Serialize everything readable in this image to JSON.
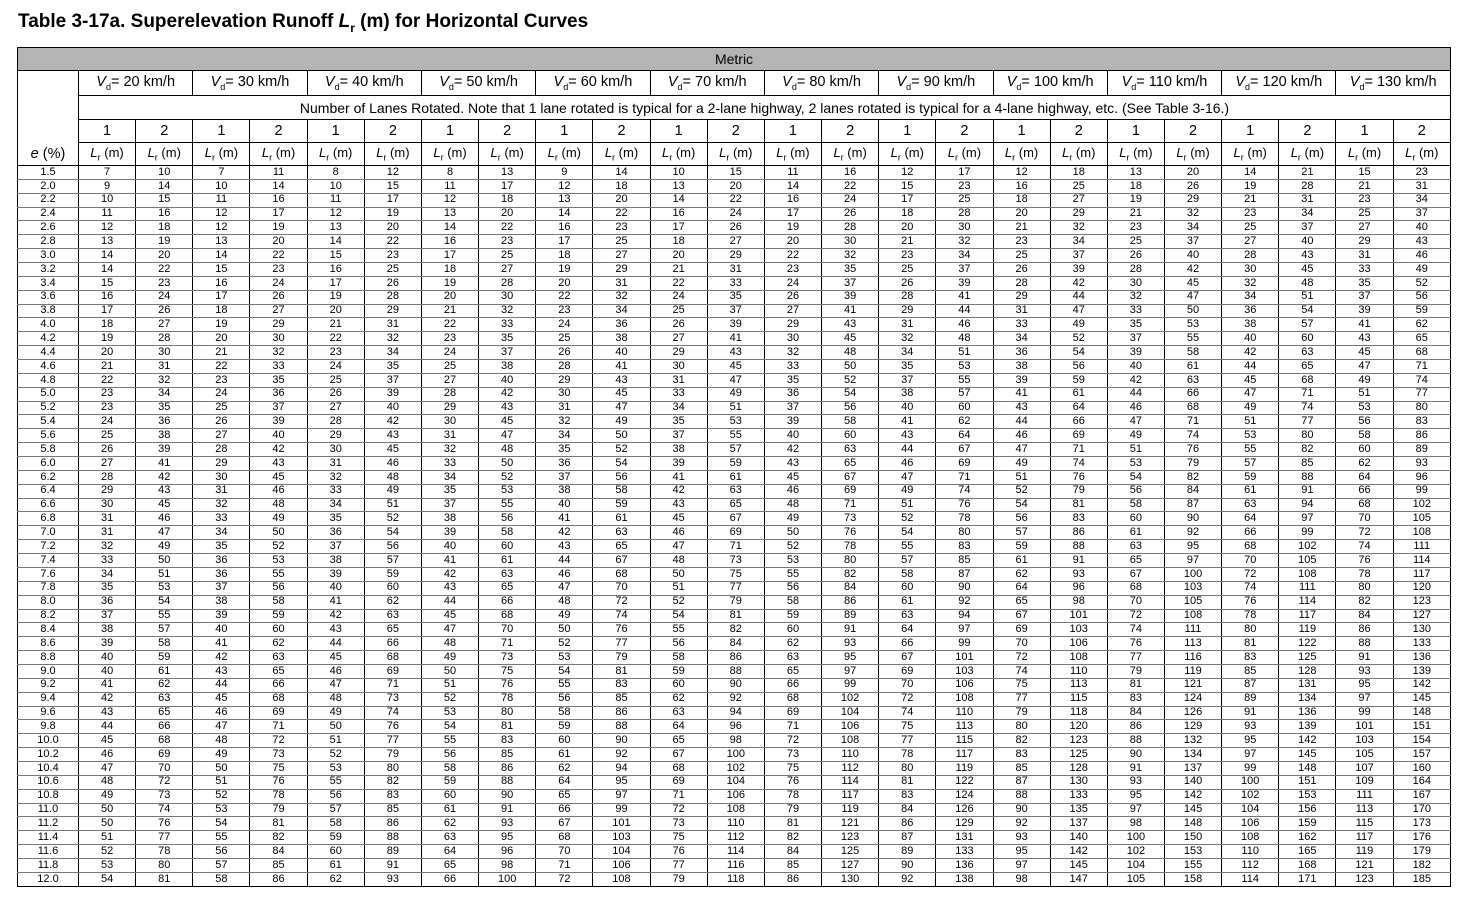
{
  "title": {
    "prefix": "Table 3-17a. Superelevation Runoff ",
    "var": "L",
    "sub": "r",
    "suffix": " (m) for Horizontal Curves"
  },
  "header": {
    "metric": "Metric",
    "e_label": "e (%)",
    "speeds": [
      "20 km/h",
      "30 km/h",
      "40 km/h",
      "50 km/h",
      "60 km/h",
      "70 km/h",
      "80 km/h",
      "90 km/h",
      "100 km/h",
      "110 km/h",
      "120 km/h",
      "130 km/h"
    ],
    "speed_var": "V",
    "speed_sub": "d",
    "note": "Number of Lanes Rotated. Note that 1 lane rotated is typical for a 2-lane highway, 2 lanes rotated is typical for a 4-lane highway, etc. (See Table 3-16.)",
    "lanes": [
      "1",
      "2"
    ],
    "unit_var": "L",
    "unit_sub": "r",
    "unit_suffix": " (m)"
  },
  "rows": [
    [
      "1.5",
      "7",
      "10",
      "7",
      "11",
      "8",
      "12",
      "8",
      "13",
      "9",
      "14",
      "10",
      "15",
      "11",
      "16",
      "12",
      "17",
      "12",
      "18",
      "13",
      "20",
      "14",
      "21",
      "15",
      "23"
    ],
    [
      "2.0",
      "9",
      "14",
      "10",
      "14",
      "10",
      "15",
      "11",
      "17",
      "12",
      "18",
      "13",
      "20",
      "14",
      "22",
      "15",
      "23",
      "16",
      "25",
      "18",
      "26",
      "19",
      "28",
      "21",
      "31"
    ],
    [
      "2.2",
      "10",
      "15",
      "11",
      "16",
      "11",
      "17",
      "12",
      "18",
      "13",
      "20",
      "14",
      "22",
      "16",
      "24",
      "17",
      "25",
      "18",
      "27",
      "19",
      "29",
      "21",
      "31",
      "23",
      "34"
    ],
    [
      "2.4",
      "11",
      "16",
      "12",
      "17",
      "12",
      "19",
      "13",
      "20",
      "14",
      "22",
      "16",
      "24",
      "17",
      "26",
      "18",
      "28",
      "20",
      "29",
      "21",
      "32",
      "23",
      "34",
      "25",
      "37"
    ],
    [
      "2.6",
      "12",
      "18",
      "12",
      "19",
      "13",
      "20",
      "14",
      "22",
      "16",
      "23",
      "17",
      "26",
      "19",
      "28",
      "20",
      "30",
      "21",
      "32",
      "23",
      "34",
      "25",
      "37",
      "27",
      "40"
    ],
    [
      "2.8",
      "13",
      "19",
      "13",
      "20",
      "14",
      "22",
      "16",
      "23",
      "17",
      "25",
      "18",
      "27",
      "20",
      "30",
      "21",
      "32",
      "23",
      "34",
      "25",
      "37",
      "27",
      "40",
      "29",
      "43"
    ],
    [
      "3.0",
      "14",
      "20",
      "14",
      "22",
      "15",
      "23",
      "17",
      "25",
      "18",
      "27",
      "20",
      "29",
      "22",
      "32",
      "23",
      "34",
      "25",
      "37",
      "26",
      "40",
      "28",
      "43",
      "31",
      "46"
    ],
    [
      "3.2",
      "14",
      "22",
      "15",
      "23",
      "16",
      "25",
      "18",
      "27",
      "19",
      "29",
      "21",
      "31",
      "23",
      "35",
      "25",
      "37",
      "26",
      "39",
      "28",
      "42",
      "30",
      "45",
      "33",
      "49"
    ],
    [
      "3.4",
      "15",
      "23",
      "16",
      "24",
      "17",
      "26",
      "19",
      "28",
      "20",
      "31",
      "22",
      "33",
      "24",
      "37",
      "26",
      "39",
      "28",
      "42",
      "30",
      "45",
      "32",
      "48",
      "35",
      "52"
    ],
    [
      "3.6",
      "16",
      "24",
      "17",
      "26",
      "19",
      "28",
      "20",
      "30",
      "22",
      "32",
      "24",
      "35",
      "26",
      "39",
      "28",
      "41",
      "29",
      "44",
      "32",
      "47",
      "34",
      "51",
      "37",
      "56"
    ],
    [
      "3.8",
      "17",
      "26",
      "18",
      "27",
      "20",
      "29",
      "21",
      "32",
      "23",
      "34",
      "25",
      "37",
      "27",
      "41",
      "29",
      "44",
      "31",
      "47",
      "33",
      "50",
      "36",
      "54",
      "39",
      "59"
    ],
    [
      "4.0",
      "18",
      "27",
      "19",
      "29",
      "21",
      "31",
      "22",
      "33",
      "24",
      "36",
      "26",
      "39",
      "29",
      "43",
      "31",
      "46",
      "33",
      "49",
      "35",
      "53",
      "38",
      "57",
      "41",
      "62"
    ],
    [
      "4.2",
      "19",
      "28",
      "20",
      "30",
      "22",
      "32",
      "23",
      "35",
      "25",
      "38",
      "27",
      "41",
      "30",
      "45",
      "32",
      "48",
      "34",
      "52",
      "37",
      "55",
      "40",
      "60",
      "43",
      "65"
    ],
    [
      "4.4",
      "20",
      "30",
      "21",
      "32",
      "23",
      "34",
      "24",
      "37",
      "26",
      "40",
      "29",
      "43",
      "32",
      "48",
      "34",
      "51",
      "36",
      "54",
      "39",
      "58",
      "42",
      "63",
      "45",
      "68"
    ],
    [
      "4.6",
      "21",
      "31",
      "22",
      "33",
      "24",
      "35",
      "25",
      "38",
      "28",
      "41",
      "30",
      "45",
      "33",
      "50",
      "35",
      "53",
      "38",
      "56",
      "40",
      "61",
      "44",
      "65",
      "47",
      "71"
    ],
    [
      "4.8",
      "22",
      "32",
      "23",
      "35",
      "25",
      "37",
      "27",
      "40",
      "29",
      "43",
      "31",
      "47",
      "35",
      "52",
      "37",
      "55",
      "39",
      "59",
      "42",
      "63",
      "45",
      "68",
      "49",
      "74"
    ],
    [
      "5.0",
      "23",
      "34",
      "24",
      "36",
      "26",
      "39",
      "28",
      "42",
      "30",
      "45",
      "33",
      "49",
      "36",
      "54",
      "38",
      "57",
      "41",
      "61",
      "44",
      "66",
      "47",
      "71",
      "51",
      "77"
    ],
    [
      "5.2",
      "23",
      "35",
      "25",
      "37",
      "27",
      "40",
      "29",
      "43",
      "31",
      "47",
      "34",
      "51",
      "37",
      "56",
      "40",
      "60",
      "43",
      "64",
      "46",
      "68",
      "49",
      "74",
      "53",
      "80"
    ],
    [
      "5.4",
      "24",
      "36",
      "26",
      "39",
      "28",
      "42",
      "30",
      "45",
      "32",
      "49",
      "35",
      "53",
      "39",
      "58",
      "41",
      "62",
      "44",
      "66",
      "47",
      "71",
      "51",
      "77",
      "56",
      "83"
    ],
    [
      "5.6",
      "25",
      "38",
      "27",
      "40",
      "29",
      "43",
      "31",
      "47",
      "34",
      "50",
      "37",
      "55",
      "40",
      "60",
      "43",
      "64",
      "46",
      "69",
      "49",
      "74",
      "53",
      "80",
      "58",
      "86"
    ],
    [
      "5.8",
      "26",
      "39",
      "28",
      "42",
      "30",
      "45",
      "32",
      "48",
      "35",
      "52",
      "38",
      "57",
      "42",
      "63",
      "44",
      "67",
      "47",
      "71",
      "51",
      "76",
      "55",
      "82",
      "60",
      "89"
    ],
    [
      "6.0",
      "27",
      "41",
      "29",
      "43",
      "31",
      "46",
      "33",
      "50",
      "36",
      "54",
      "39",
      "59",
      "43",
      "65",
      "46",
      "69",
      "49",
      "74",
      "53",
      "79",
      "57",
      "85",
      "62",
      "93"
    ],
    [
      "6.2",
      "28",
      "42",
      "30",
      "45",
      "32",
      "48",
      "34",
      "52",
      "37",
      "56",
      "41",
      "61",
      "45",
      "67",
      "47",
      "71",
      "51",
      "76",
      "54",
      "82",
      "59",
      "88",
      "64",
      "96"
    ],
    [
      "6.4",
      "29",
      "43",
      "31",
      "46",
      "33",
      "49",
      "35",
      "53",
      "38",
      "58",
      "42",
      "63",
      "46",
      "69",
      "49",
      "74",
      "52",
      "79",
      "56",
      "84",
      "61",
      "91",
      "66",
      "99"
    ],
    [
      "6.6",
      "30",
      "45",
      "32",
      "48",
      "34",
      "51",
      "37",
      "55",
      "40",
      "59",
      "43",
      "65",
      "48",
      "71",
      "51",
      "76",
      "54",
      "81",
      "58",
      "87",
      "63",
      "94",
      "68",
      "102"
    ],
    [
      "6.8",
      "31",
      "46",
      "33",
      "49",
      "35",
      "52",
      "38",
      "56",
      "41",
      "61",
      "45",
      "67",
      "49",
      "73",
      "52",
      "78",
      "56",
      "83",
      "60",
      "90",
      "64",
      "97",
      "70",
      "105"
    ],
    [
      "7.0",
      "31",
      "47",
      "34",
      "50",
      "36",
      "54",
      "39",
      "58",
      "42",
      "63",
      "46",
      "69",
      "50",
      "76",
      "54",
      "80",
      "57",
      "86",
      "61",
      "92",
      "66",
      "99",
      "72",
      "108"
    ],
    [
      "7.2",
      "32",
      "49",
      "35",
      "52",
      "37",
      "56",
      "40",
      "60",
      "43",
      "65",
      "47",
      "71",
      "52",
      "78",
      "55",
      "83",
      "59",
      "88",
      "63",
      "95",
      "68",
      "102",
      "74",
      "111"
    ],
    [
      "7.4",
      "33",
      "50",
      "36",
      "53",
      "38",
      "57",
      "41",
      "61",
      "44",
      "67",
      "48",
      "73",
      "53",
      "80",
      "57",
      "85",
      "61",
      "91",
      "65",
      "97",
      "70",
      "105",
      "76",
      "114"
    ],
    [
      "7.6",
      "34",
      "51",
      "36",
      "55",
      "39",
      "59",
      "42",
      "63",
      "46",
      "68",
      "50",
      "75",
      "55",
      "82",
      "58",
      "87",
      "62",
      "93",
      "67",
      "100",
      "72",
      "108",
      "78",
      "117"
    ],
    [
      "7.8",
      "35",
      "53",
      "37",
      "56",
      "40",
      "60",
      "43",
      "65",
      "47",
      "70",
      "51",
      "77",
      "56",
      "84",
      "60",
      "90",
      "64",
      "96",
      "68",
      "103",
      "74",
      "111",
      "80",
      "120"
    ],
    [
      "8.0",
      "36",
      "54",
      "38",
      "58",
      "41",
      "62",
      "44",
      "66",
      "48",
      "72",
      "52",
      "79",
      "58",
      "86",
      "61",
      "92",
      "65",
      "98",
      "70",
      "105",
      "76",
      "114",
      "82",
      "123"
    ],
    [
      "8.2",
      "37",
      "55",
      "39",
      "59",
      "42",
      "63",
      "45",
      "68",
      "49",
      "74",
      "54",
      "81",
      "59",
      "89",
      "63",
      "94",
      "67",
      "101",
      "72",
      "108",
      "78",
      "117",
      "84",
      "127"
    ],
    [
      "8.4",
      "38",
      "57",
      "40",
      "60",
      "43",
      "65",
      "47",
      "70",
      "50",
      "76",
      "55",
      "82",
      "60",
      "91",
      "64",
      "97",
      "69",
      "103",
      "74",
      "111",
      "80",
      "119",
      "86",
      "130"
    ],
    [
      "8.6",
      "39",
      "58",
      "41",
      "62",
      "44",
      "66",
      "48",
      "71",
      "52",
      "77",
      "56",
      "84",
      "62",
      "93",
      "66",
      "99",
      "70",
      "106",
      "76",
      "113",
      "81",
      "122",
      "88",
      "133"
    ],
    [
      "8.8",
      "40",
      "59",
      "42",
      "63",
      "45",
      "68",
      "49",
      "73",
      "53",
      "79",
      "58",
      "86",
      "63",
      "95",
      "67",
      "101",
      "72",
      "108",
      "77",
      "116",
      "83",
      "125",
      "91",
      "136"
    ],
    [
      "9.0",
      "40",
      "61",
      "43",
      "65",
      "46",
      "69",
      "50",
      "75",
      "54",
      "81",
      "59",
      "88",
      "65",
      "97",
      "69",
      "103",
      "74",
      "110",
      "79",
      "119",
      "85",
      "128",
      "93",
      "139"
    ],
    [
      "9.2",
      "41",
      "62",
      "44",
      "66",
      "47",
      "71",
      "51",
      "76",
      "55",
      "83",
      "60",
      "90",
      "66",
      "99",
      "70",
      "106",
      "75",
      "113",
      "81",
      "121",
      "87",
      "131",
      "95",
      "142"
    ],
    [
      "9.4",
      "42",
      "63",
      "45",
      "68",
      "48",
      "73",
      "52",
      "78",
      "56",
      "85",
      "62",
      "92",
      "68",
      "102",
      "72",
      "108",
      "77",
      "115",
      "83",
      "124",
      "89",
      "134",
      "97",
      "145"
    ],
    [
      "9.6",
      "43",
      "65",
      "46",
      "69",
      "49",
      "74",
      "53",
      "80",
      "58",
      "86",
      "63",
      "94",
      "69",
      "104",
      "74",
      "110",
      "79",
      "118",
      "84",
      "126",
      "91",
      "136",
      "99",
      "148"
    ],
    [
      "9.8",
      "44",
      "66",
      "47",
      "71",
      "50",
      "76",
      "54",
      "81",
      "59",
      "88",
      "64",
      "96",
      "71",
      "106",
      "75",
      "113",
      "80",
      "120",
      "86",
      "129",
      "93",
      "139",
      "101",
      "151"
    ],
    [
      "10.0",
      "45",
      "68",
      "48",
      "72",
      "51",
      "77",
      "55",
      "83",
      "60",
      "90",
      "65",
      "98",
      "72",
      "108",
      "77",
      "115",
      "82",
      "123",
      "88",
      "132",
      "95",
      "142",
      "103",
      "154"
    ],
    [
      "10.2",
      "46",
      "69",
      "49",
      "73",
      "52",
      "79",
      "56",
      "85",
      "61",
      "92",
      "67",
      "100",
      "73",
      "110",
      "78",
      "117",
      "83",
      "125",
      "90",
      "134",
      "97",
      "145",
      "105",
      "157"
    ],
    [
      "10.4",
      "47",
      "70",
      "50",
      "75",
      "53",
      "80",
      "58",
      "86",
      "62",
      "94",
      "68",
      "102",
      "75",
      "112",
      "80",
      "119",
      "85",
      "128",
      "91",
      "137",
      "99",
      "148",
      "107",
      "160"
    ],
    [
      "10.6",
      "48",
      "72",
      "51",
      "76",
      "55",
      "82",
      "59",
      "88",
      "64",
      "95",
      "69",
      "104",
      "76",
      "114",
      "81",
      "122",
      "87",
      "130",
      "93",
      "140",
      "100",
      "151",
      "109",
      "164"
    ],
    [
      "10.8",
      "49",
      "73",
      "52",
      "78",
      "56",
      "83",
      "60",
      "90",
      "65",
      "97",
      "71",
      "106",
      "78",
      "117",
      "83",
      "124",
      "88",
      "133",
      "95",
      "142",
      "102",
      "153",
      "111",
      "167"
    ],
    [
      "11.0",
      "50",
      "74",
      "53",
      "79",
      "57",
      "85",
      "61",
      "91",
      "66",
      "99",
      "72",
      "108",
      "79",
      "119",
      "84",
      "126",
      "90",
      "135",
      "97",
      "145",
      "104",
      "156",
      "113",
      "170"
    ],
    [
      "11.2",
      "50",
      "76",
      "54",
      "81",
      "58",
      "86",
      "62",
      "93",
      "67",
      "101",
      "73",
      "110",
      "81",
      "121",
      "86",
      "129",
      "92",
      "137",
      "98",
      "148",
      "106",
      "159",
      "115",
      "173"
    ],
    [
      "11.4",
      "51",
      "77",
      "55",
      "82",
      "59",
      "88",
      "63",
      "95",
      "68",
      "103",
      "75",
      "112",
      "82",
      "123",
      "87",
      "131",
      "93",
      "140",
      "100",
      "150",
      "108",
      "162",
      "117",
      "176"
    ],
    [
      "11.6",
      "52",
      "78",
      "56",
      "84",
      "60",
      "89",
      "64",
      "96",
      "70",
      "104",
      "76",
      "114",
      "84",
      "125",
      "89",
      "133",
      "95",
      "142",
      "102",
      "153",
      "110",
      "165",
      "119",
      "179"
    ],
    [
      "11.8",
      "53",
      "80",
      "57",
      "85",
      "61",
      "91",
      "65",
      "98",
      "71",
      "106",
      "77",
      "116",
      "85",
      "127",
      "90",
      "136",
      "97",
      "145",
      "104",
      "155",
      "112",
      "168",
      "121",
      "182"
    ],
    [
      "12.0",
      "54",
      "81",
      "58",
      "86",
      "62",
      "93",
      "66",
      "100",
      "72",
      "108",
      "79",
      "118",
      "86",
      "130",
      "92",
      "138",
      "98",
      "147",
      "105",
      "158",
      "114",
      "171",
      "123",
      "185"
    ]
  ]
}
